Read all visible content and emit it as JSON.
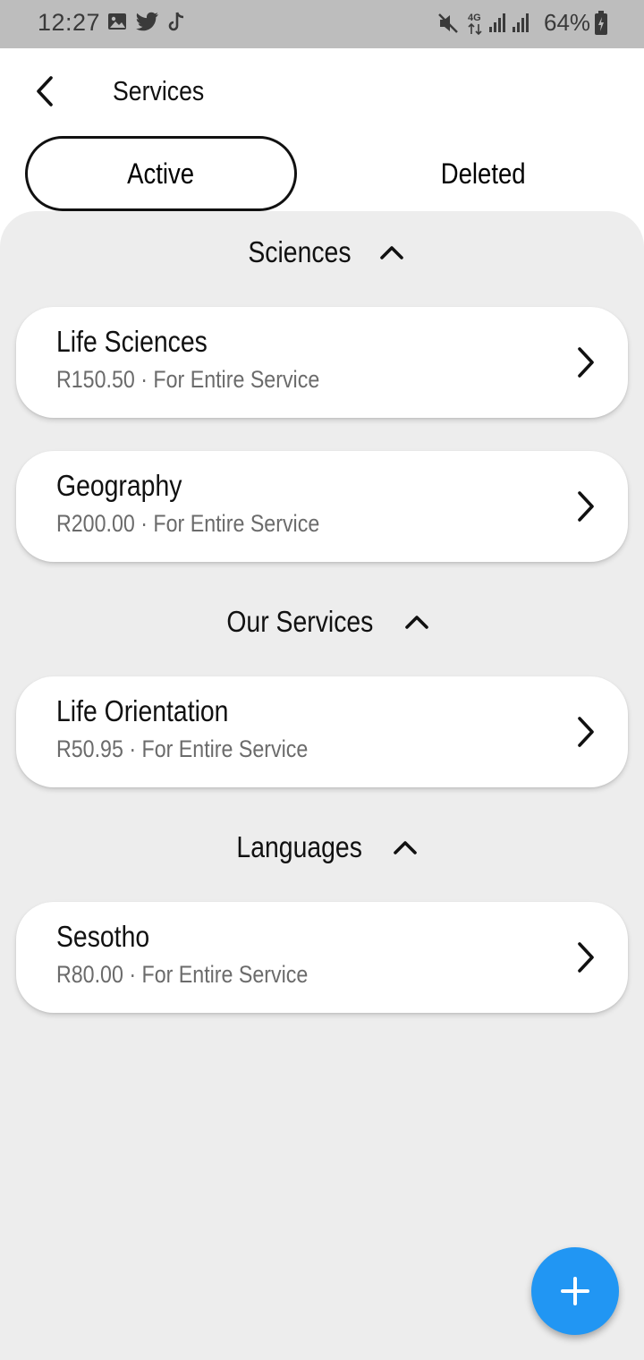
{
  "status_bar": {
    "time": "12:27",
    "battery_percent": "64%",
    "network": "4G",
    "left_icons": [
      "image-icon",
      "twitter-icon",
      "tiktok-icon"
    ],
    "right_icons": [
      "mute-icon",
      "4g-icon",
      "signal-icon",
      "signal-icon",
      "battery-charging-icon"
    ]
  },
  "header": {
    "title": "Services",
    "back_icon": "chevron-left-icon"
  },
  "tabs": [
    {
      "label": "Active",
      "selected": true
    },
    {
      "label": "Deleted",
      "selected": false
    }
  ],
  "sections": [
    {
      "title": "Sciences",
      "expanded": true,
      "items": [
        {
          "name": "Life Sciences",
          "meta": "R150.50 · For Entire Service"
        },
        {
          "name": "Geography",
          "meta": "R200.00 · For Entire Service"
        }
      ]
    },
    {
      "title": "Our Services",
      "expanded": true,
      "items": [
        {
          "name": "Life Orientation",
          "meta": "R50.95 · For Entire Service"
        }
      ]
    },
    {
      "title": "Languages",
      "expanded": true,
      "items": [
        {
          "name": "Sesotho",
          "meta": "R80.00 · For Entire Service"
        }
      ]
    }
  ],
  "fab": {
    "icon": "plus-icon"
  },
  "colors": {
    "accent": "#2196f3",
    "panel_background": "#ededed",
    "status_bar": "#bdbdbd",
    "secondary_text": "#6b6b6b"
  }
}
